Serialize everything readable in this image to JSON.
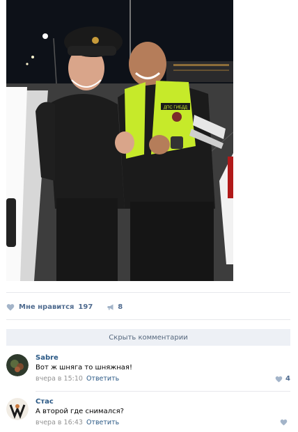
{
  "post": {
    "photo_alt": "",
    "likes_label": "Мне нравится",
    "likes_count": "197",
    "shares_count": "8"
  },
  "comments_toggle": {
    "label": "Скрыть комментарии"
  },
  "comments": [
    {
      "author": "Sabre",
      "text": "Вот ж шняга то шняжная!",
      "time": "вчера в 15:10",
      "reply_label": "Ответить",
      "likes": "4"
    },
    {
      "author": "Стас",
      "text": "А второй где снимался?",
      "time": "вчера в 16:43",
      "reply_label": "Ответить",
      "likes": ""
    }
  ],
  "colors": {
    "link": "#2a5885",
    "action": "#4f6b8f",
    "muted": "#939393",
    "toggle_bg": "#edf0f5",
    "divider": "#e7e8ec",
    "vest": "#c6ea2a"
  },
  "photo_labels": {
    "vest_badge": "ДПС ГИБДД"
  }
}
